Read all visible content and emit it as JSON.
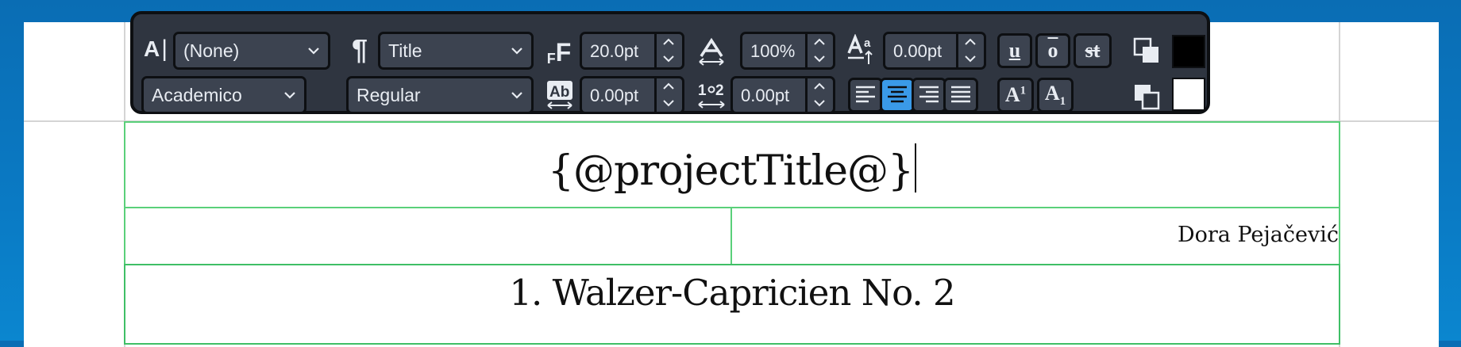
{
  "toolbar": {
    "paragraph_style": "(None)",
    "character_style": "Title",
    "font_size": "20.0pt",
    "horizontal_scale": "100%",
    "baseline_shift": "0.00pt",
    "font_family": "Academico",
    "font_style": "Regular",
    "letter_spacing": "0.00pt",
    "line_spacing": "0.00pt",
    "underline_label": "u",
    "overline_label": "o",
    "strikethrough_label": "st",
    "superscript_label": "A",
    "superscript_mark": "1",
    "subscript_label": "A",
    "subscript_mark": "1",
    "alignment_selected": "center",
    "text_color": "#000000",
    "background_color": "#ffffff",
    "icons": {
      "paragraph_style": "text-style-icon",
      "paragraph": "pilcrow-icon",
      "font_size": "font-size-icon",
      "horizontal_scale": "horizontal-scale-icon",
      "baseline_shift": "baseline-shift-icon",
      "letter_spacing": "letter-spacing-icon",
      "line_spacing": "line-spacing-icon"
    }
  },
  "page": {
    "title_text": "{@projectTitle@}",
    "composer_text": "Dora Pejačević",
    "subtitle_text": "1. Walzer-Capricien No. 2"
  }
}
